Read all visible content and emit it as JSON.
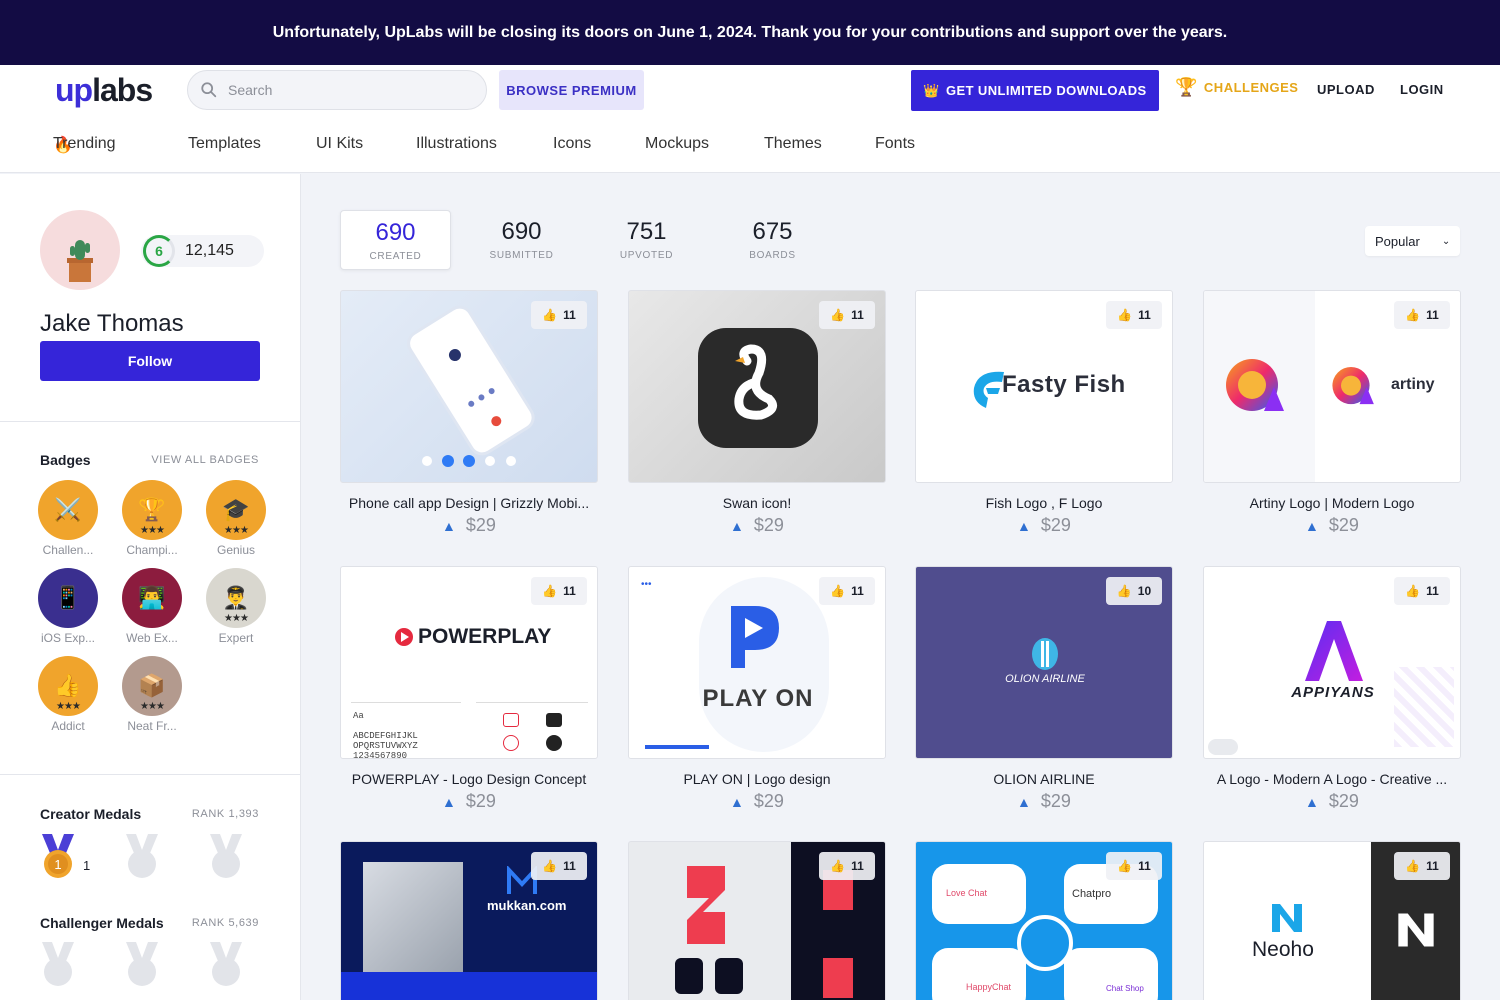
{
  "banner": "Unfortunately, UpLabs will be closing its doors on June 1, 2024. Thank you for your contributions and support over the years.",
  "header": {
    "logo_up": "up",
    "logo_labs": "labs",
    "search_placeholder": "Search",
    "browse": "BROWSE PREMIUM",
    "unlimited": "GET UNLIMITED DOWNLOADS",
    "challenges": "CHALLENGES",
    "upload": "UPLOAD",
    "login": "LOGIN"
  },
  "nav": [
    "Trending",
    "Templates",
    "UI Kits",
    "Illustrations",
    "Icons",
    "Mockups",
    "Themes",
    "Fonts"
  ],
  "profile": {
    "level": "6",
    "points": "12,145",
    "name": "Jake Thomas",
    "follow": "Follow"
  },
  "badges": {
    "title": "Badges",
    "view_all": "VIEW ALL BADGES",
    "items": [
      {
        "label": "Challen...",
        "color": "#f0a42c",
        "emoji": "⚔️",
        "stars": ""
      },
      {
        "label": "Champi...",
        "color": "#f0a42c",
        "emoji": "🏆",
        "stars": "★★★"
      },
      {
        "label": "Genius",
        "color": "#f0a42c",
        "emoji": "🎓",
        "stars": "★★★"
      },
      {
        "label": "iOS Exp...",
        "color": "#3a2f8f",
        "emoji": "📱",
        "stars": ""
      },
      {
        "label": "Web Ex...",
        "color": "#8c1c3e",
        "emoji": "👨‍💻",
        "stars": ""
      },
      {
        "label": "Expert",
        "color": "#d9d7cf",
        "emoji": "👨‍✈️",
        "stars": "★★★"
      },
      {
        "label": "Addict",
        "color": "#f0a42c",
        "emoji": "👍",
        "stars": "★★★"
      },
      {
        "label": "Neat Fr...",
        "color": "#b39a8e",
        "emoji": "📦",
        "stars": "★★★"
      }
    ]
  },
  "creator_medals": {
    "title": "Creator Medals",
    "rank": "RANK 1,393",
    "count": "1"
  },
  "challenger_medals": {
    "title": "Challenger Medals",
    "rank": "RANK 5,639"
  },
  "stats": [
    {
      "num": "690",
      "cap": "CREATED"
    },
    {
      "num": "690",
      "cap": "SUBMITTED"
    },
    {
      "num": "751",
      "cap": "UPVOTED"
    },
    {
      "num": "675",
      "cap": "BOARDS"
    }
  ],
  "sort": "Popular",
  "cards": [
    {
      "title": "Phone call app Design | Grizzly Mobi...",
      "price": "$29",
      "likes": "11"
    },
    {
      "title": "Swan icon!",
      "price": "$29",
      "likes": "11"
    },
    {
      "title": "Fish Logo , F Logo",
      "price": "$29",
      "likes": "11"
    },
    {
      "title": "Artiny Logo | Modern Logo",
      "price": "$29",
      "likes": "11"
    },
    {
      "title": "POWERPLAY - Logo Design Concept",
      "price": "$29",
      "likes": "11"
    },
    {
      "title": "PLAY ON | Logo design",
      "price": "$29",
      "likes": "11"
    },
    {
      "title": "OLION AIRLINE",
      "price": "$29",
      "likes": "10"
    },
    {
      "title": "A Logo - Modern A Logo - Creative ...",
      "price": "$29",
      "likes": "11"
    },
    {
      "title": "",
      "price": "",
      "likes": "11"
    },
    {
      "title": "",
      "price": "",
      "likes": "11"
    },
    {
      "title": "",
      "price": "",
      "likes": "11"
    },
    {
      "title": "",
      "price": "",
      "likes": "11"
    }
  ],
  "thumb_text": {
    "fasty": "Fasty Fish",
    "artiny": "artiny",
    "powerplay": "POWERPLAY",
    "playon": "PLAY ON",
    "olion": "OLION AIRLINE",
    "appiyans": "APPIYANS",
    "mukkan": "mukkan.com",
    "neoho": "Neoho",
    "lovechat": "Love Chat",
    "chatpro": "Chatpro",
    "happychat": "HappyChat",
    "chatshop": "Chat Shop"
  }
}
